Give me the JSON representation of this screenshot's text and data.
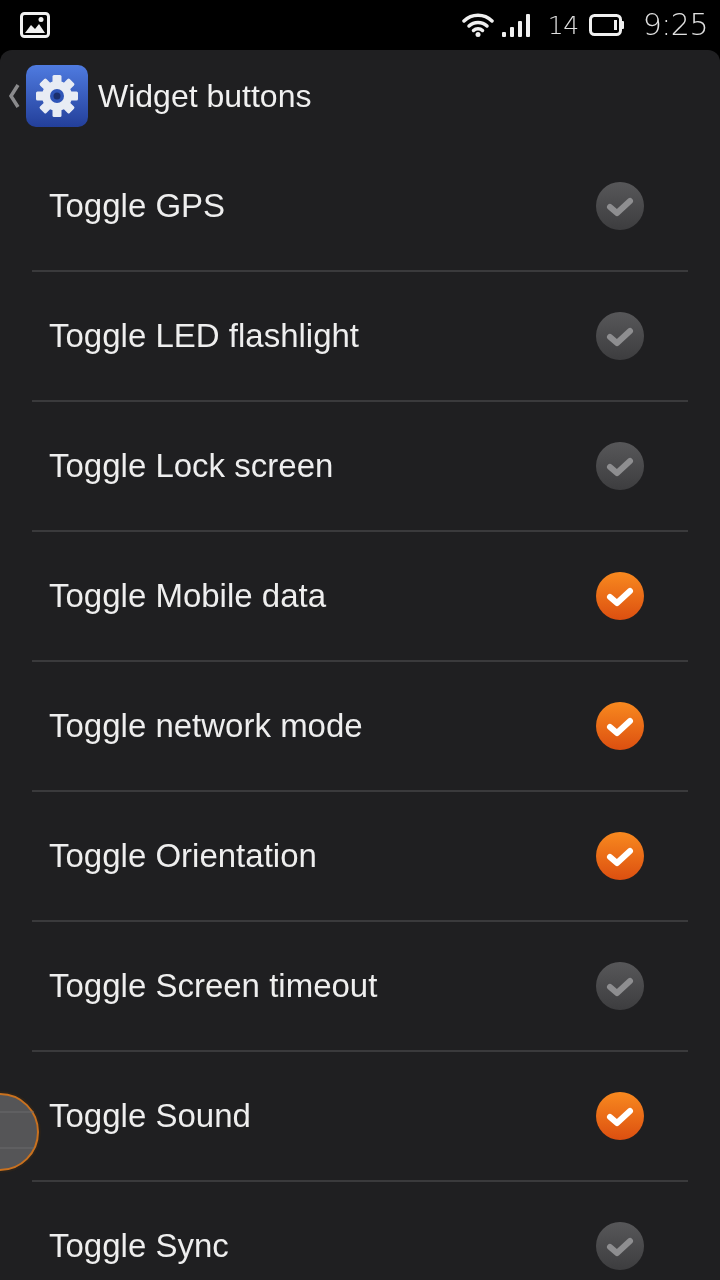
{
  "status_bar": {
    "battery_level_text": "14",
    "time": "9:25"
  },
  "header": {
    "title": "Widget buttons"
  },
  "items": [
    {
      "label": "Toggle GPS",
      "checked": false
    },
    {
      "label": "Toggle LED flashlight",
      "checked": false
    },
    {
      "label": "Toggle Lock screen",
      "checked": false
    },
    {
      "label": "Toggle Mobile data",
      "checked": true
    },
    {
      "label": "Toggle network mode",
      "checked": true
    },
    {
      "label": "Toggle Orientation",
      "checked": true
    },
    {
      "label": "Toggle Screen timeout",
      "checked": false
    },
    {
      "label": "Toggle Sound",
      "checked": true
    },
    {
      "label": "Toggle Sync",
      "checked": false
    }
  ]
}
